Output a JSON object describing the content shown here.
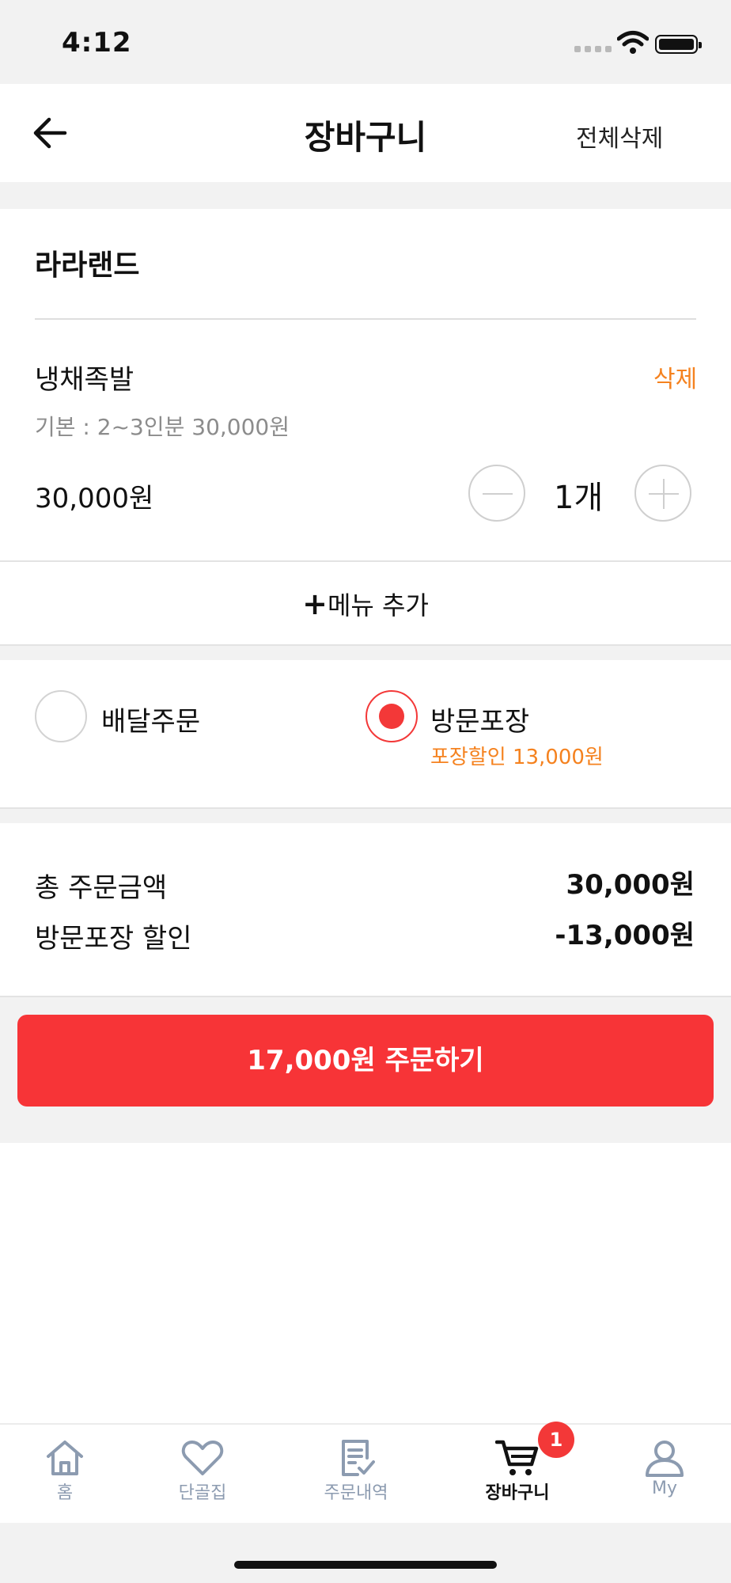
{
  "status_bar": {
    "time": "4:12"
  },
  "header": {
    "title": "장바구니",
    "delete_all_label": "전체삭제"
  },
  "store": {
    "name": "라라랜드",
    "item": {
      "name": "냉채족발",
      "delete_label": "삭제",
      "option": "기본 : 2~3인분  30,000원",
      "price": "30,000원",
      "quantity": "1개"
    },
    "add_menu_plus": "+",
    "add_menu_label": "메뉴 추가"
  },
  "order_type": {
    "delivery_label": "배달주문",
    "pickup_label": "방문포장",
    "pickup_discount": "포장할인 13,000원",
    "selected": "pickup"
  },
  "totals": {
    "order_amount_label": "총 주문금액",
    "order_amount_value": "30,000원",
    "discount_label": "방문포장 할인",
    "discount_value": "-13,000원"
  },
  "order_button_label": "17,000원 주문하기",
  "tab_bar": {
    "items": [
      {
        "label": "홈",
        "icon": "home-icon"
      },
      {
        "label": "단골집",
        "icon": "heart-icon"
      },
      {
        "label": "주문내역",
        "icon": "order-list-icon"
      },
      {
        "label": "장바구니",
        "icon": "cart-icon",
        "active": true
      },
      {
        "label": "My",
        "icon": "user-icon"
      }
    ],
    "cart_badge": "1"
  },
  "colors": {
    "accent_red": "#f73437",
    "accent_orange": "#f5821f",
    "inactive_tab": "#8c9bb0"
  }
}
